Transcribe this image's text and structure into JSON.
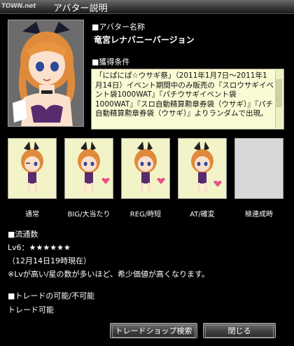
{
  "window": {
    "logo_text": "TOWN.net",
    "title": "アバター説明"
  },
  "avatar": {
    "name_heading": "■アバター名称",
    "name": "竜宮レナバニーバージョン",
    "condition_heading": "■獲得条件",
    "condition_text": "「にぱにぱ☆ウサギ祭」（2011年1月7日〜2011年1月14日）イベント期間中のみ販売の『スロウサギイベント袋1000WAT』『パチウサギイベント袋1000WAT』『スロ自動精算勲章券袋（ウサギ）』『パチ自動精算勲章券袋（ウサギ）』よりランダムで出現。"
  },
  "variants": [
    {
      "label": "通常"
    },
    {
      "label": "BIG/大当たり"
    },
    {
      "label": "REG/時短"
    },
    {
      "label": "AT/確変"
    },
    {
      "label": "極連成時"
    }
  ],
  "circulation": {
    "heading": "■流通数",
    "level_text": "Lv6：★★★★★★",
    "date_text": "（12月14日19時現在）",
    "note": "※Lvが高い/星の数が多いほど、希少価値が高くなります。"
  },
  "trade": {
    "heading": "■トレードの可能/不可能",
    "status": "トレード可能"
  },
  "buttons": {
    "trade_shop": "トレードショップ検索",
    "close": "閉じる"
  },
  "colors": {
    "condition_bg": "#fafad4",
    "slot_bg": "#f3f3c8",
    "empty_slot_bg": "#d8d8d8"
  }
}
